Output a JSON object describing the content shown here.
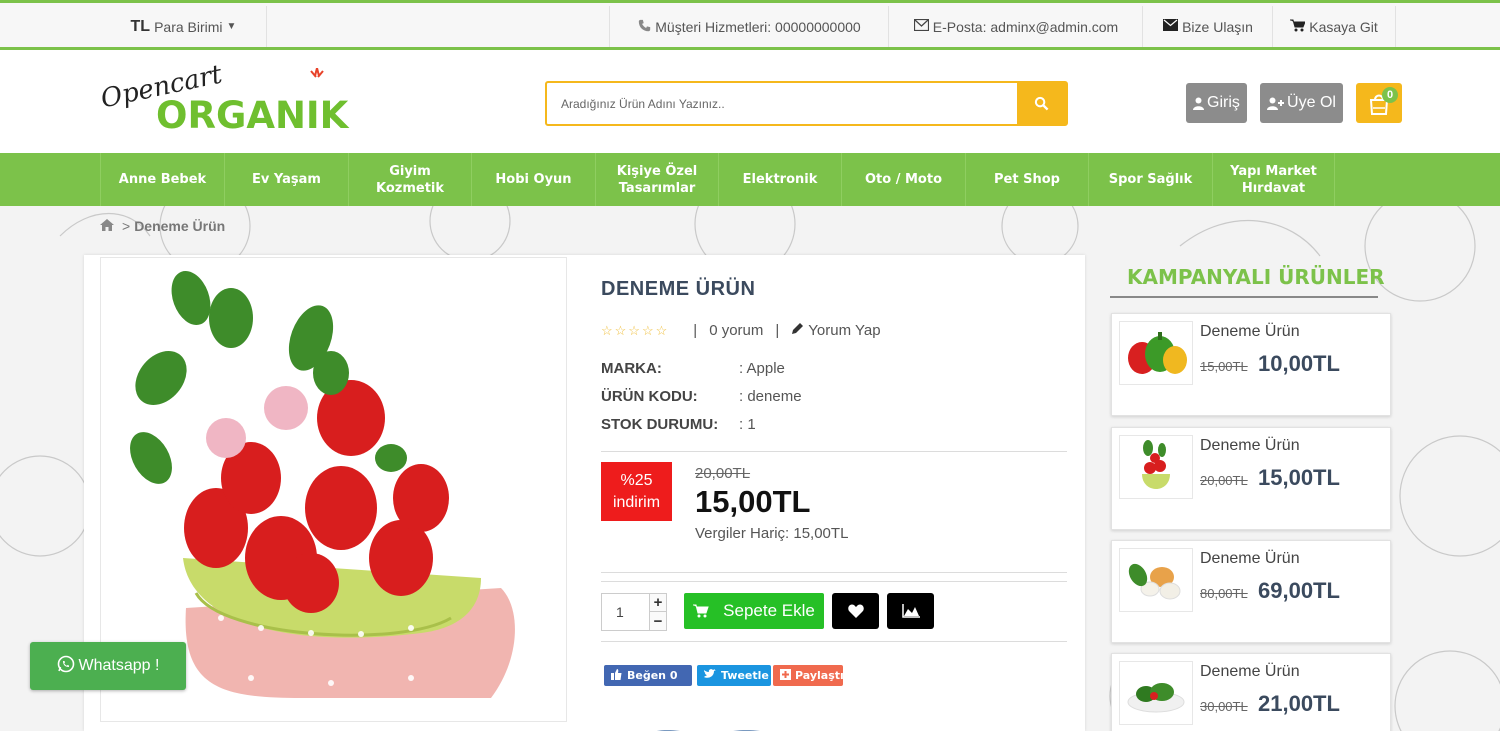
{
  "topbar": {
    "currency_symbol": "TL",
    "currency_label": "Para Birimi",
    "support_label": "Müşteri Hizmetleri: 00000000000",
    "email_label": "E-Posta: adminx@admin.com",
    "contact_label": "Bize Ulaşın",
    "checkout_label": "Kasaya Git"
  },
  "logo": {
    "line1": "Opencart",
    "line2": "ORGANIK"
  },
  "search": {
    "placeholder": "Aradığınız Ürün Adını Yazınız.."
  },
  "account": {
    "login_label": "Giriş",
    "register_label": "Üye Ol",
    "cart_count": "0"
  },
  "nav": {
    "items": [
      {
        "label": "Anne Bebek"
      },
      {
        "label": "Ev Yaşam"
      },
      {
        "label": "Giyim\nKozmetik"
      },
      {
        "label": "Hobi Oyun"
      },
      {
        "label": "Kişiye Özel\nTasarımlar"
      },
      {
        "label": "Elektronik"
      },
      {
        "label": "Oto / Moto"
      },
      {
        "label": "Pet Shop"
      },
      {
        "label": "Spor Sağlık"
      },
      {
        "label": "Yapı Market\nHırdavat"
      }
    ]
  },
  "breadcrumb": {
    "separator": ">",
    "current": "Deneme Ürün"
  },
  "product": {
    "title": "DENEME ÜRÜN",
    "rating_stars": "☆☆☆☆☆",
    "review_count_label": "0 yorum",
    "write_review_label": "Yorum Yap",
    "specs": [
      {
        "key": "MARKA:",
        "value": ": Apple"
      },
      {
        "key": "ÜRÜN KODU:",
        "value": ": deneme"
      },
      {
        "key": "STOK DURUMU:",
        "value": ": 1"
      }
    ],
    "discount_line1": "%25",
    "discount_line2": "indirim",
    "old_price": "20,00TL",
    "price": "15,00TL",
    "tax_label": "Vergiler Hariç: 15,00TL",
    "quantity": "1",
    "add_to_cart_label": "Sepete Ekle"
  },
  "social": {
    "like_label": "Beğen 0",
    "tweet_label": "Tweetle",
    "share_label": "Paylaştır"
  },
  "campaign": {
    "title": "KAMPANYALI ÜRÜNLER",
    "items": [
      {
        "name": "Deneme Ürün",
        "old_price": "15,00TL",
        "price": "10,00TL"
      },
      {
        "name": "Deneme Ürün",
        "old_price": "20,00TL",
        "price": "15,00TL"
      },
      {
        "name": "Deneme Ürün",
        "old_price": "80,00TL",
        "price": "69,00TL"
      },
      {
        "name": "Deneme Ürün",
        "old_price": "30,00TL",
        "price": "21,00TL"
      }
    ]
  },
  "whatsapp": {
    "label": "Whatsapp !"
  },
  "colors": {
    "brand_green": "#7cc24a",
    "accent_yellow": "#f5b81c",
    "discount_red": "#ee1c1c",
    "cart_green": "#26c026"
  }
}
